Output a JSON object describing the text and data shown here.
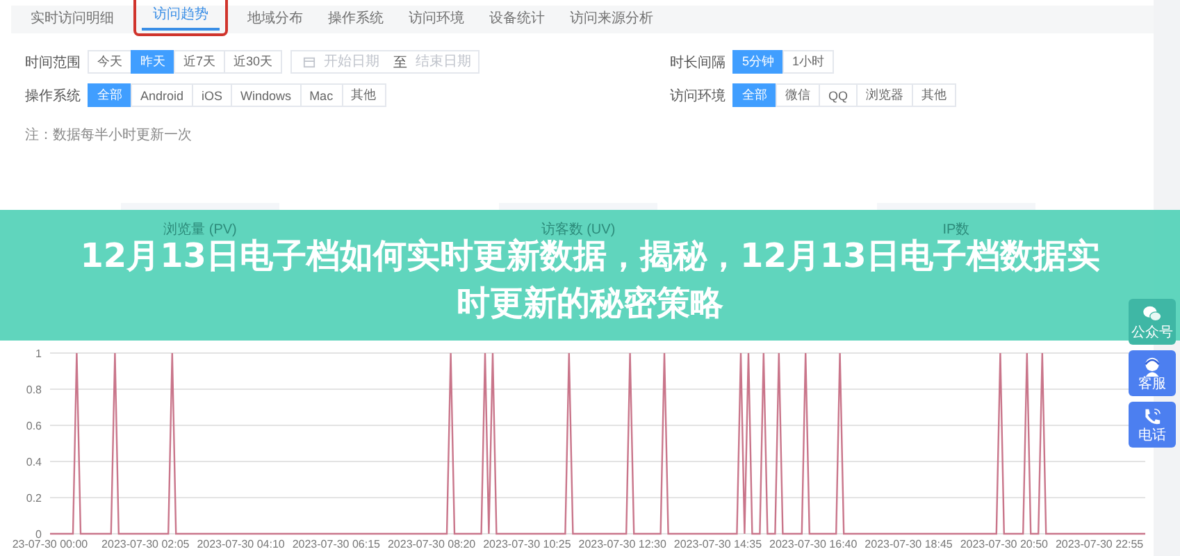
{
  "tabs": [
    {
      "label": "实时访问明细",
      "selected": false,
      "annotated": false
    },
    {
      "label": "访问趋势",
      "selected": true,
      "annotated": true
    },
    {
      "label": "地域分布",
      "selected": false,
      "annotated": false
    },
    {
      "label": "操作系统",
      "selected": false,
      "annotated": false
    },
    {
      "label": "访问环境",
      "selected": false,
      "annotated": false
    },
    {
      "label": "设备统计",
      "selected": false,
      "annotated": false
    },
    {
      "label": "访问来源分析",
      "selected": false,
      "annotated": false
    }
  ],
  "filters_left": [
    {
      "label": "时间范围",
      "options": [
        {
          "label": "今天",
          "selected": false
        },
        {
          "label": "昨天",
          "selected": true
        },
        {
          "label": "近7天",
          "selected": false
        },
        {
          "label": "近30天",
          "selected": false
        }
      ],
      "date_range": {
        "start_placeholder": "开始日期",
        "separator": "至",
        "end_placeholder": "结束日期"
      }
    },
    {
      "label": "操作系统",
      "options": [
        {
          "label": "全部",
          "selected": true
        },
        {
          "label": "Android",
          "selected": false
        },
        {
          "label": "iOS",
          "selected": false
        },
        {
          "label": "Windows",
          "selected": false
        },
        {
          "label": "Mac",
          "selected": false
        },
        {
          "label": "其他",
          "selected": false
        }
      ]
    }
  ],
  "filters_right": [
    {
      "label": "时长间隔",
      "options": [
        {
          "label": "5分钟",
          "selected": true
        },
        {
          "label": "1小时",
          "selected": false
        }
      ]
    },
    {
      "label": "访问环境",
      "options": [
        {
          "label": "全部",
          "selected": true
        },
        {
          "label": "微信",
          "selected": false
        },
        {
          "label": "QQ",
          "selected": false
        },
        {
          "label": "浏览器",
          "selected": false
        },
        {
          "label": "其他",
          "selected": false
        }
      ]
    }
  ],
  "note": "注：数据每半小时更新一次",
  "stat_cards": [
    {
      "label": "浏览量 (PV)"
    },
    {
      "label": "访客数 (UV)"
    },
    {
      "label": "IP数"
    }
  ],
  "banner": {
    "title": "12月13日电子档如何实时更新数据，揭秘，12月13日电子档数据实时更新的秘密策略"
  },
  "side_buttons": [
    {
      "kind": "wechat",
      "label": "公众号"
    },
    {
      "kind": "service",
      "label": "客服"
    },
    {
      "kind": "phone",
      "label": "电话"
    }
  ],
  "chart": {
    "chart_data": {
      "type": "line",
      "grid": true,
      "ylim": [
        0,
        1
      ],
      "yticks": [
        0,
        0.2,
        0.4,
        0.6,
        0.8,
        1
      ],
      "categories": [
        "23-07-30 00:00",
        null,
        null,
        null,
        null,
        null,
        null,
        null,
        null,
        null,
        null,
        null,
        null,
        null,
        null,
        null,
        null,
        null,
        null,
        null,
        null,
        null,
        null,
        null,
        null,
        "2023-07-30 02:05",
        null,
        null,
        null,
        null,
        null,
        null,
        null,
        null,
        null,
        null,
        null,
        null,
        null,
        null,
        null,
        null,
        null,
        null,
        null,
        null,
        null,
        null,
        null,
        null,
        "2023-07-30 04:10",
        null,
        null,
        null,
        null,
        null,
        null,
        null,
        null,
        null,
        null,
        null,
        null,
        null,
        null,
        null,
        null,
        null,
        null,
        null,
        null,
        null,
        null,
        null,
        null,
        "2023-07-30 06:15",
        null,
        null,
        null,
        null,
        null,
        null,
        null,
        null,
        null,
        null,
        null,
        null,
        null,
        null,
        null,
        null,
        null,
        null,
        null,
        null,
        null,
        null,
        null,
        null,
        "2023-07-30 08:20",
        null,
        null,
        null,
        null,
        null,
        null,
        null,
        null,
        null,
        null,
        null,
        null,
        null,
        null,
        null,
        null,
        null,
        null,
        null,
        null,
        null,
        null,
        null,
        null,
        "2023-07-30 10:25",
        null,
        null,
        null,
        null,
        null,
        null,
        null,
        null,
        null,
        null,
        null,
        null,
        null,
        null,
        null,
        null,
        null,
        null,
        null,
        null,
        null,
        null,
        null,
        null,
        "2023-07-30 12:30",
        null,
        null,
        null,
        null,
        null,
        null,
        null,
        null,
        null,
        null,
        null,
        null,
        null,
        null,
        null,
        null,
        null,
        null,
        null,
        null,
        null,
        null,
        null,
        null,
        "2023-07-30 14:35",
        null,
        null,
        null,
        null,
        null,
        null,
        null,
        null,
        null,
        null,
        null,
        null,
        null,
        null,
        null,
        null,
        null,
        null,
        null,
        null,
        null,
        null,
        null,
        null,
        "2023-07-30 16:40",
        null,
        null,
        null,
        null,
        null,
        null,
        null,
        null,
        null,
        null,
        null,
        null,
        null,
        null,
        null,
        null,
        null,
        null,
        null,
        null,
        null,
        null,
        null,
        null,
        "2023-07-30 18:45",
        null,
        null,
        null,
        null,
        null,
        null,
        null,
        null,
        null,
        null,
        null,
        null,
        null,
        null,
        null,
        null,
        null,
        null,
        null,
        null,
        null,
        null,
        null,
        null,
        "2023-07-30 20:50",
        null,
        null,
        null,
        null,
        null,
        null,
        null,
        null,
        null,
        null,
        null,
        null,
        null,
        null,
        null,
        null,
        null,
        null,
        null,
        null,
        null,
        null,
        null,
        null,
        "2023-07-30 22:55",
        null,
        null,
        null,
        null,
        null,
        null,
        null,
        null,
        null,
        null,
        null,
        null
      ],
      "series": [
        {
          "color": "#c9758a",
          "values": [
            0,
            0,
            0,
            0,
            0,
            0,
            0,
            1,
            0,
            0,
            0,
            0,
            0,
            0,
            0,
            0,
            0,
            1,
            0,
            0,
            0,
            0,
            0,
            0,
            0,
            0,
            0,
            0,
            0,
            0,
            0,
            0,
            1,
            0,
            0,
            0,
            0,
            0,
            0,
            0,
            0,
            0,
            0,
            0,
            0,
            0,
            0,
            0,
            0,
            0,
            0,
            0,
            0,
            0,
            0,
            0,
            0,
            0,
            0,
            0,
            0,
            0,
            0,
            0,
            0,
            0,
            0,
            0,
            0,
            0,
            0,
            0,
            0,
            0,
            0,
            0,
            0,
            0,
            0,
            0,
            0,
            0,
            0,
            0,
            0,
            0,
            0,
            0,
            0,
            0,
            0,
            0,
            0,
            0,
            0,
            0,
            0,
            0,
            0,
            0,
            0,
            0,
            0,
            0,
            0,
            1,
            0,
            0,
            0,
            0,
            0,
            0,
            0,
            0,
            1,
            0,
            1,
            0,
            0,
            0,
            0,
            0,
            0,
            0,
            0,
            0,
            0,
            0,
            0,
            0,
            0,
            0,
            0,
            0,
            0,
            0,
            1,
            0,
            0,
            0,
            0,
            0,
            0,
            0,
            0,
            0,
            0,
            0,
            0,
            0,
            0,
            0,
            1,
            0,
            0,
            0,
            0,
            0,
            0,
            0,
            0,
            1,
            0,
            0,
            0,
            0,
            0,
            0,
            0,
            0,
            0,
            0,
            0,
            0,
            0,
            0,
            0,
            0,
            0,
            0,
            0,
            1,
            0,
            1,
            0,
            0,
            0,
            1,
            0,
            0,
            0,
            1,
            0,
            0,
            0,
            0,
            0,
            0,
            1,
            0,
            0,
            0,
            0,
            0,
            0,
            0,
            0,
            1,
            0,
            0,
            0,
            0,
            0,
            0,
            0,
            0,
            0,
            0,
            0,
            0,
            0,
            0,
            0,
            0,
            0,
            0,
            0,
            0,
            0,
            0,
            0,
            0,
            0,
            0,
            0,
            0,
            0,
            0,
            0,
            0,
            0,
            0,
            0,
            0,
            0,
            0,
            0,
            0,
            0,
            1,
            0,
            0,
            0,
            0,
            0,
            0,
            1,
            0,
            0,
            0,
            1,
            0,
            0,
            0,
            0,
            0,
            0,
            0,
            0,
            0,
            0,
            0,
            0,
            0,
            0,
            0,
            0,
            0,
            0,
            0,
            0,
            0,
            0,
            0,
            0,
            0,
            0,
            0
          ]
        }
      ]
    }
  }
}
